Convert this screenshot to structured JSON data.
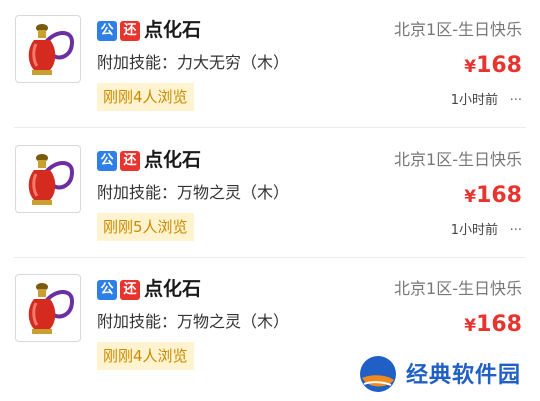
{
  "listings": [
    {
      "tag_public": "公",
      "tag_return": "还",
      "name": "点化石",
      "skill": "附加技能：力大无穷（木）",
      "views": "刚刚4人浏览",
      "server": "北京1区-生日快乐",
      "currency": "¥",
      "price": "168",
      "time": "1小时前",
      "more": "···"
    },
    {
      "tag_public": "公",
      "tag_return": "还",
      "name": "点化石",
      "skill": "附加技能：万物之灵（木）",
      "views": "刚刚5人浏览",
      "server": "北京1区-生日快乐",
      "currency": "¥",
      "price": "168",
      "time": "1小时前",
      "more": "···"
    },
    {
      "tag_public": "公",
      "tag_return": "还",
      "name": "点化石",
      "skill": "附加技能：万物之灵（木）",
      "views": "刚刚4人浏览",
      "server": "北京1区-生日快乐",
      "currency": "¥",
      "price": "168",
      "time": "",
      "more": ""
    }
  ],
  "item_icon": "red-gourd-vase-icon",
  "colors": {
    "price": "#e8342f",
    "tag_public": "#2f7fe8",
    "tag_return": "#e8342f",
    "views_bg": "#fff4cf",
    "views_text": "#c98a00",
    "watermark_text": "#1f5fc6"
  },
  "watermark": {
    "text": "经典软件园",
    "icon": "globe-logo-icon"
  }
}
